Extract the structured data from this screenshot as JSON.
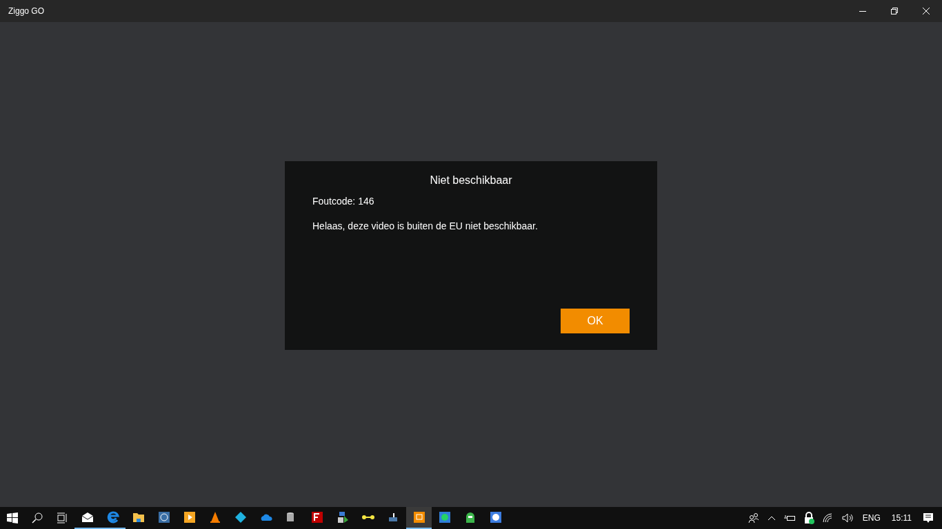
{
  "window": {
    "title": "Ziggo GO"
  },
  "dialog": {
    "title": "Niet beschikbaar",
    "code": "Foutcode: 146",
    "message": "Helaas, deze video is buiten de EU niet beschikbaar.",
    "button": "OK"
  },
  "taskbar": {
    "apps": [
      {
        "kind": "mail",
        "running": true,
        "selected": false
      },
      {
        "kind": "edge",
        "running": true,
        "selected": false
      },
      {
        "kind": "folder",
        "running": false,
        "selected": false
      },
      {
        "kind": "pp",
        "running": false,
        "selected": false
      },
      {
        "kind": "player",
        "running": false,
        "selected": false
      },
      {
        "kind": "vlc",
        "running": false,
        "selected": false
      },
      {
        "kind": "kodi",
        "running": false,
        "selected": false
      },
      {
        "kind": "cloud",
        "running": false,
        "selected": false
      },
      {
        "kind": "database",
        "running": false,
        "selected": false
      },
      {
        "kind": "filezilla",
        "running": false,
        "selected": false
      },
      {
        "kind": "transfer",
        "running": false,
        "selected": false
      },
      {
        "kind": "bone",
        "running": false,
        "selected": false
      },
      {
        "kind": "chart",
        "running": false,
        "selected": false
      },
      {
        "kind": "ziggo",
        "running": true,
        "selected": true
      },
      {
        "kind": "whatsapp",
        "running": false,
        "selected": false
      },
      {
        "kind": "vpn",
        "running": false,
        "selected": false
      },
      {
        "kind": "film",
        "running": false,
        "selected": false
      }
    ],
    "language": "ENG",
    "time": "15:11"
  }
}
